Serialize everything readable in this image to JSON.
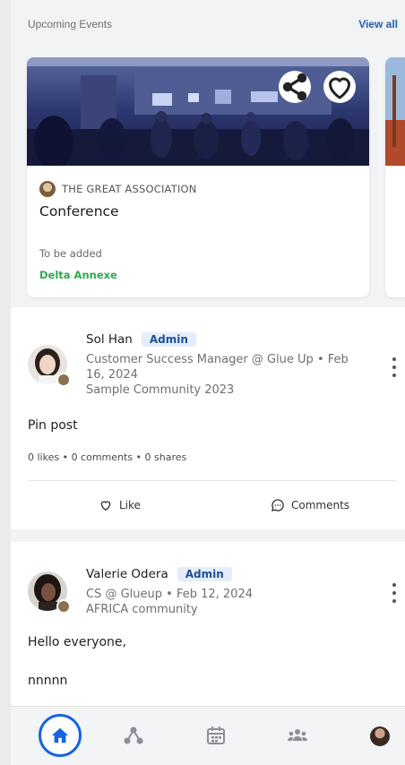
{
  "events": {
    "header": "Upcoming Events",
    "view_all": "View all",
    "cards": [
      {
        "organizer": "THE GREAT ASSOCIATION",
        "title": "Conference",
        "date": "To be added",
        "venue": "Delta Annexe"
      }
    ]
  },
  "posts": [
    {
      "author": "Sol Han",
      "badge": "Admin",
      "meta_line1": "Customer Success Manager @ Glue Up • Feb",
      "meta_line2": "16, 2024",
      "community": "Sample Community 2023",
      "body": "Pin post",
      "stats": "0 likes  •  0 comments  •  0 shares",
      "like_label": "Like",
      "comments_label": "Comments"
    },
    {
      "author": "Valerie Odera",
      "badge": "Admin",
      "meta_line1": "CS @ Glueup • Feb 12, 2024",
      "community": "AFRICA community",
      "body_line1": "Hello everyone,",
      "body_line2": "nnnnn"
    }
  ],
  "nav": {
    "items": [
      "home-icon",
      "groups-icon",
      "calendar-icon",
      "members-icon",
      "profile-avatar"
    ],
    "active": "home-icon",
    "active_color": "#1565e0"
  },
  "colors": {
    "accent": "#1f5fa8",
    "venue_green": "#2eaa4f",
    "admin_badge_bg": "#e4eefb"
  }
}
